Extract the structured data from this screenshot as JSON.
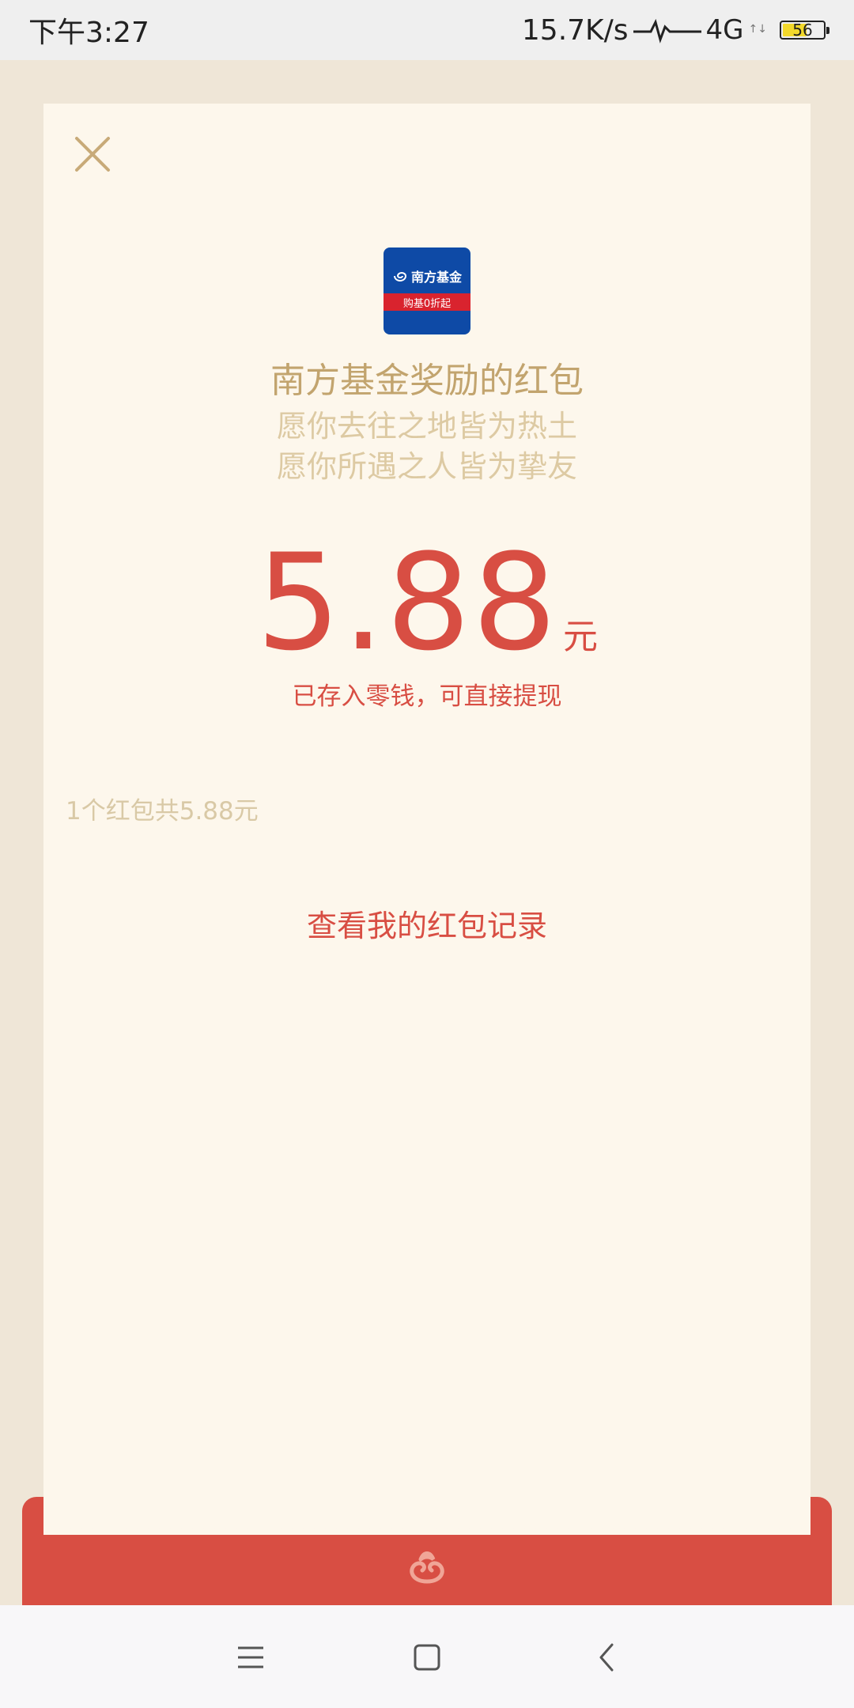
{
  "status_bar": {
    "time": "下午3:27",
    "network_speed": "15.7K/s",
    "network_type": "4G",
    "network_arrows": "↑↓",
    "battery_level": "56",
    "battery_fraction": 0.56,
    "battery_fill_color": "#f3d92b"
  },
  "red_packet": {
    "sender_logo": {
      "icon": "nanfang-fund-logo",
      "brand_text": "南方基金",
      "ribbon_text": "购基0折起"
    },
    "title": "南方基金奖励的红包",
    "blessing_line_1": "愿你去往之地皆为热土",
    "blessing_line_2": "愿你所遇之人皆为挚友",
    "amount": "5.88",
    "currency_unit": "元",
    "saved_note": "已存入零钱，可直接提现",
    "summary": "1个红包共5.88元",
    "records_link": "查看我的红包记录"
  },
  "colors": {
    "accent_red": "#d84e43",
    "gold_text": "#c2a46e",
    "paper": "#fdf7ec",
    "backdrop": "#efe6d7"
  },
  "nav_bar": {
    "icons": [
      "menu-icon",
      "home-square-icon",
      "back-chevron-icon"
    ]
  }
}
